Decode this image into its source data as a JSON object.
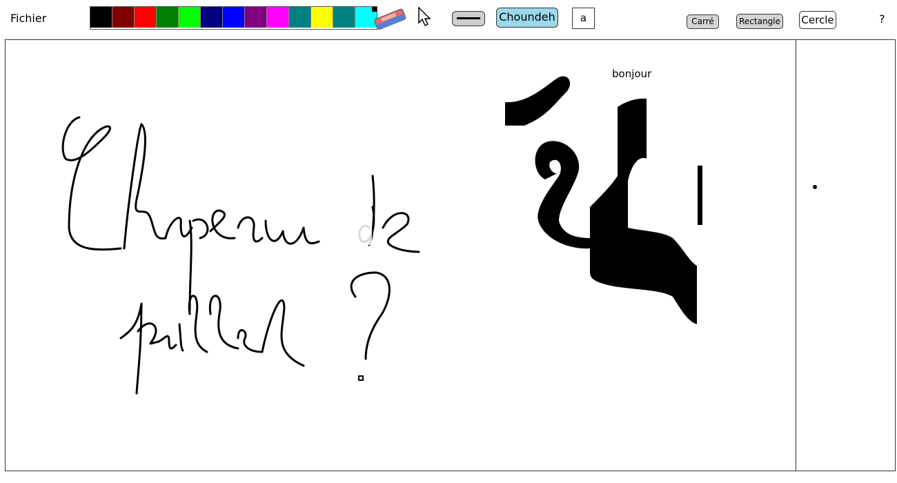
{
  "menu": {
    "fichier": "Fichier"
  },
  "palette": [
    "#000000",
    "#800000",
    "#ff0000",
    "#008000",
    "#00ff00",
    "#000080",
    "#0000ff",
    "#800080",
    "#ff00ff",
    "#008080",
    "#ffff00",
    "#008080",
    "#00ffff"
  ],
  "toolbar": {
    "font_name": "Choundeh",
    "text_tool": "a",
    "square": "Carré",
    "rectangle": "Rectangle",
    "circle": "Cercle",
    "help": "?"
  },
  "icons": {
    "eraser": "eraser-icon",
    "cursor": "cursor-arrow-icon",
    "stroke": "stroke-width-icon"
  },
  "canvas": {
    "text_label": "bonjour"
  }
}
